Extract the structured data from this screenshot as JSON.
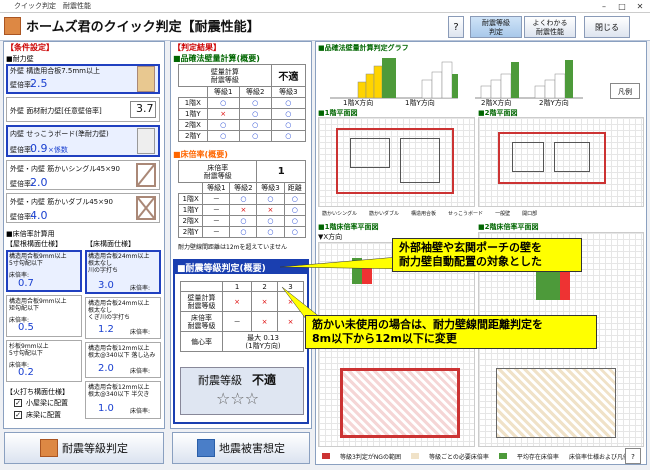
{
  "window": {
    "title": "クイック判定　耐震性能"
  },
  "header": {
    "title": "ホームズ君のクイック判定【耐震性能】",
    "help_label": "?",
    "tab_grade": "耐震等級\n判定",
    "tab_faq": "よくわかる\n耐震性能",
    "close_label": "閉じる"
  },
  "conditions": {
    "title": "【条件設定】",
    "bearing_title": "■耐力壁",
    "walls": [
      {
        "name": "外壁 構造用合板7.5mm以上",
        "rate_label": "壁倍率:",
        "rate": "2.5"
      },
      {
        "name": "外壁 面材耐力壁[任意壁倍率]",
        "rate_label": "",
        "rate": "3.7"
      },
      {
        "name": "内壁 せっこうボード(準耐力壁)",
        "rate_label": "壁倍率:",
        "rate": "0.9",
        "suffix": "×係数"
      },
      {
        "name": "外壁・内壁 筋かいシングル45×90",
        "rate_label": "壁倍率:",
        "rate": "2.0"
      },
      {
        "name": "外壁・内壁 筋かいダブル45×90",
        "rate_label": "壁倍率:",
        "rate": "4.0"
      }
    ],
    "floor_title": "■床倍率計算用",
    "roof_spec": "【屋根構面仕様】",
    "floor_spec": "【床構面仕様】",
    "roof_items": [
      {
        "text": "構造用合板9mm以上\n5寸勾配以下",
        "rate_label": "床倍率:",
        "rate": "0.7"
      },
      {
        "text": "構造用合板9mm以上\n矩勾配以下",
        "rate_label": "床倍率:",
        "rate": "0.5"
      },
      {
        "text": "杉板9mm以上\n5寸勾配以下",
        "rate_label": "床倍率:",
        "rate": "0.2"
      }
    ],
    "floor_items": [
      {
        "text": "構造用合板24mm以上\n根太なし\n川の字打ち",
        "rate_label": "床倍率:",
        "rate": "3.0"
      },
      {
        "text": "構造用合板24mm以上\n根太なし\nくぎ川の字打ち",
        "rate_label": "床倍率:",
        "rate": "1.2"
      },
      {
        "text": "構造用合板12mm以上\n根太@340以下 落し込み",
        "rate_label": "床倍率:",
        "rate": "2.0"
      },
      {
        "text": "構造用合板12mm以上\n根太@340以下 半欠き",
        "rate_label": "床倍率:",
        "rate": "1.0"
      }
    ],
    "hiuchi_title": "【火打ち構面仕様】",
    "hiuchi": [
      {
        "label": "小屋梁に配置",
        "checked": true
      },
      {
        "label": "床梁に配置",
        "checked": true
      }
    ]
  },
  "results": {
    "title": "【判定結果】",
    "wall_section": "■品確法壁量計算(概要)",
    "wall_header_label": "壁量計算\n耐震等級",
    "wall_verdict": "不適",
    "grade_cols": [
      "等級1",
      "等級2",
      "等級3"
    ],
    "wall_rows": [
      {
        "label": "1階X",
        "vals": [
          "○",
          "○",
          "○"
        ]
      },
      {
        "label": "1階Y",
        "vals": [
          "×",
          "○",
          "○"
        ]
      },
      {
        "label": "2階X",
        "vals": [
          "○",
          "○",
          "○"
        ]
      },
      {
        "label": "2階Y",
        "vals": [
          "○",
          "○",
          "○"
        ]
      }
    ],
    "floor_section": "■床倍率(概要)",
    "floor_header_label": "床倍率\n耐震等級",
    "floor_verdict": "1",
    "floor_cols": [
      "等級1",
      "等級2",
      "等級3",
      "距離"
    ],
    "floor_rows": [
      {
        "label": "1階X",
        "vals": [
          "－",
          "○",
          "○",
          "○"
        ]
      },
      {
        "label": "1階Y",
        "vals": [
          "－",
          "×",
          "×",
          "○"
        ]
      },
      {
        "label": "2階X",
        "vals": [
          "－",
          "○",
          "○",
          "○"
        ]
      },
      {
        "label": "2階Y",
        "vals": [
          "－",
          "○",
          "○",
          "○"
        ]
      }
    ],
    "floor_note": "耐力壁線間距離は12mを超えていません",
    "seismic_section": "■耐震等級判定(概要)",
    "seismic_cols": [
      "1",
      "2",
      "3"
    ],
    "seismic_rows": [
      {
        "label": "壁量計算\n耐震等級",
        "vals": [
          "×",
          "×",
          "×"
        ]
      },
      {
        "label": "床倍率\n耐震等級",
        "vals": [
          "－",
          "×",
          "×"
        ]
      }
    ],
    "eccentric_label": "偏心率",
    "eccentric_value": "最大 0.13\n(1階Y方向)",
    "final_label": "耐震等級",
    "final_value": "不適",
    "stars": "☆☆☆"
  },
  "graph": {
    "title": "■品確法壁量計算判定グラフ",
    "floor1_label": "1階X方向",
    "floor1y_label": "1階Y方向",
    "floor2x_label": "2階X方向",
    "floor2y_label": "2階Y方向",
    "legend_button": "凡例",
    "grade_labels": [
      "等級1",
      "等級2",
      "等級3"
    ],
    "verdict": "存在壁量",
    "plan1_title": "■1階平面図",
    "plan2_title": "■2階平面図",
    "floor_plan1_title": "■1階床倍率平面図",
    "floor_plan2_title": "■2階床倍率平面図",
    "x_dir": "▼X方向",
    "legend_items": [
      "筋かいシングル",
      "筋かいダブル",
      "構造用合板",
      "せっこうボード",
      "一般壁",
      "開口部"
    ],
    "bottom_legend": [
      "等級3判定がNGの範囲",
      "等級ごとの必要床倍率",
      "平均存在床倍率",
      "床倍率仕様および凡例"
    ]
  },
  "callouts": {
    "callout1_line1": "外部袖壁や玄関ポーチの壁を",
    "callout1_line2": "耐力壁自動配置の対象とした",
    "callout2_line1": "筋かい未使用の場合は、耐力壁線間距離判定を",
    "callout2_line2": "8m以下から12m以下に変更"
  },
  "buttons": {
    "grade_judge": "耐震等級判定",
    "damage_estimate": "地震被害想定"
  },
  "colors": {
    "accent": "#1a40d0",
    "highlight": "#ffff00",
    "header_red": "#c00000",
    "graph_green": "#4d9a3a"
  }
}
